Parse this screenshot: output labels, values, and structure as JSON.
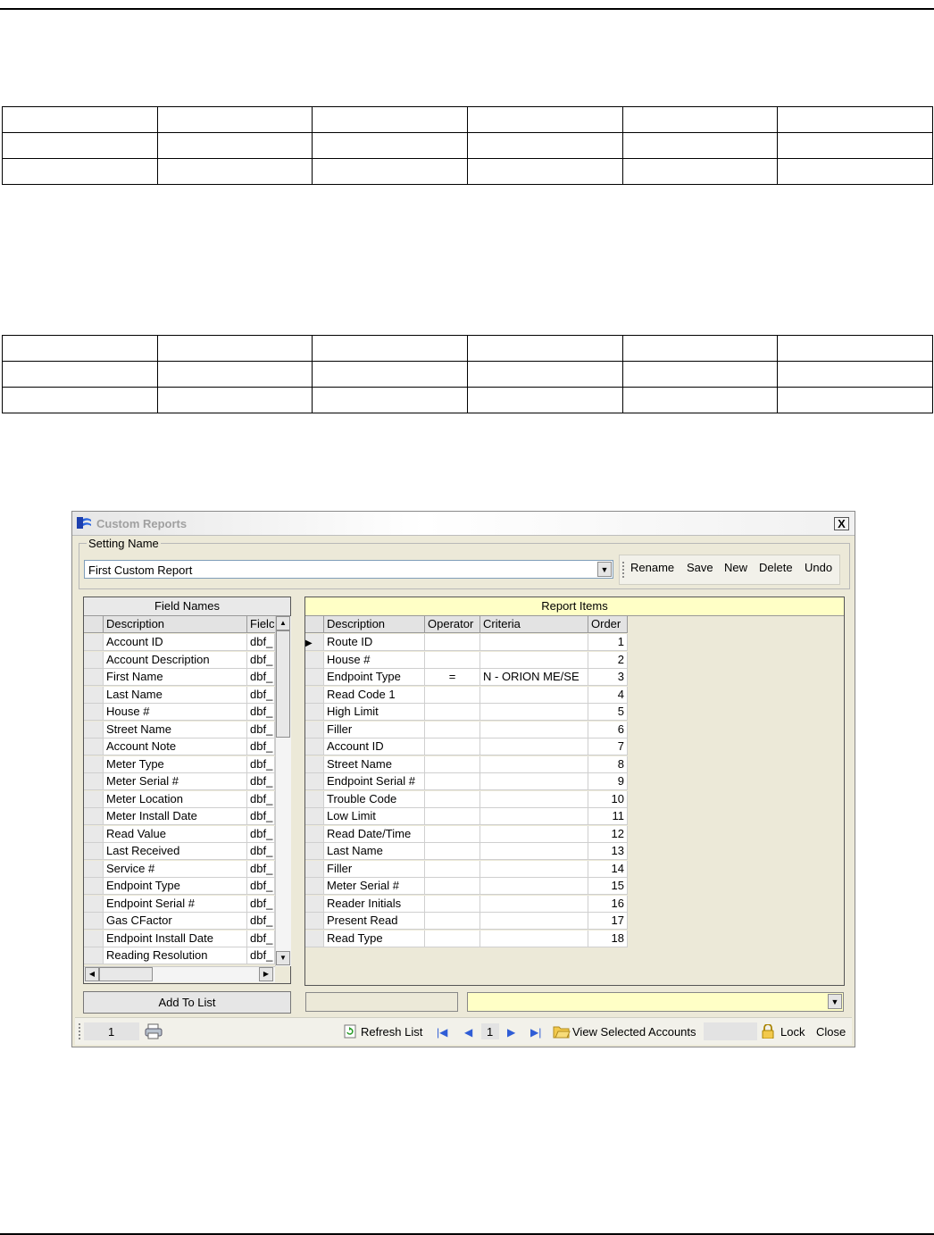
{
  "window": {
    "title": "Custom Reports",
    "close_label": "X"
  },
  "setting": {
    "group_label": "Setting Name",
    "value": "First Custom Report"
  },
  "toolbar": {
    "rename": "Rename",
    "save": "Save",
    "new": "New",
    "delete": "Delete",
    "undo": "Undo"
  },
  "field_names": {
    "header": "Field Names",
    "columns": [
      "Description",
      "Fielc"
    ],
    "rows": [
      {
        "description": "Account ID",
        "field": "dbf_"
      },
      {
        "description": "Account Description",
        "field": "dbf_"
      },
      {
        "description": "First Name",
        "field": "dbf_"
      },
      {
        "description": "Last Name",
        "field": "dbf_"
      },
      {
        "description": "House #",
        "field": "dbf_"
      },
      {
        "description": "Street Name",
        "field": "dbf_"
      },
      {
        "description": "Account Note",
        "field": "dbf_"
      },
      {
        "description": "Meter Type",
        "field": "dbf_"
      },
      {
        "description": "Meter Serial #",
        "field": "dbf_"
      },
      {
        "description": "Meter Location",
        "field": "dbf_"
      },
      {
        "description": "Meter Install Date",
        "field": "dbf_"
      },
      {
        "description": "Read Value",
        "field": "dbf_"
      },
      {
        "description": "Last Received",
        "field": "dbf_"
      },
      {
        "description": "Service #",
        "field": "dbf_"
      },
      {
        "description": "Endpoint Type",
        "field": "dbf_"
      },
      {
        "description": "Endpoint Serial #",
        "field": "dbf_"
      },
      {
        "description": "Gas CFactor",
        "field": "dbf_"
      },
      {
        "description": "Endpoint Install Date",
        "field": "dbf_"
      },
      {
        "description": "Reading Resolution",
        "field": "dbf_"
      }
    ],
    "add_button": "Add To List"
  },
  "report_items": {
    "header": "Report Items",
    "columns": [
      "Description",
      "Operator",
      "Criteria",
      "Order"
    ],
    "rows": [
      {
        "description": "Route ID",
        "operator": "",
        "criteria": "",
        "order": "1"
      },
      {
        "description": "House #",
        "operator": "",
        "criteria": "",
        "order": "2"
      },
      {
        "description": "Endpoint Type",
        "operator": "=",
        "criteria": "N - ORION ME/SE",
        "order": "3"
      },
      {
        "description": "Read Code 1",
        "operator": "",
        "criteria": "",
        "order": "4"
      },
      {
        "description": "High Limit",
        "operator": "",
        "criteria": "",
        "order": "5"
      },
      {
        "description": "Filler",
        "operator": "",
        "criteria": "",
        "order": "6"
      },
      {
        "description": "Account ID",
        "operator": "",
        "criteria": "",
        "order": "7"
      },
      {
        "description": "Street Name",
        "operator": "",
        "criteria": "",
        "order": "8"
      },
      {
        "description": "Endpoint Serial #",
        "operator": "",
        "criteria": "",
        "order": "9"
      },
      {
        "description": "Trouble Code",
        "operator": "",
        "criteria": "",
        "order": "10"
      },
      {
        "description": "Low Limit",
        "operator": "",
        "criteria": "",
        "order": "11"
      },
      {
        "description": "Read Date/Time",
        "operator": "",
        "criteria": "",
        "order": "12"
      },
      {
        "description": "Last Name",
        "operator": "",
        "criteria": "",
        "order": "13"
      },
      {
        "description": "Filler",
        "operator": "",
        "criteria": "",
        "order": "14"
      },
      {
        "description": "Meter Serial #",
        "operator": "",
        "criteria": "",
        "order": "15"
      },
      {
        "description": "Reader Initials",
        "operator": "",
        "criteria": "",
        "order": "16"
      },
      {
        "description": "Present Read",
        "operator": "",
        "criteria": "",
        "order": "17"
      },
      {
        "description": "Read Type",
        "operator": "",
        "criteria": "",
        "order": "18"
      }
    ]
  },
  "statusbar": {
    "record": "1",
    "refresh": "Refresh List",
    "page": "1",
    "view_selected": "View Selected Accounts",
    "lock": "Lock",
    "close": "Close"
  },
  "colors": {
    "report_header_bg": "#ffffc6",
    "window_bg": "#ece9d8",
    "nav_arrow": "#2f5dd6"
  }
}
